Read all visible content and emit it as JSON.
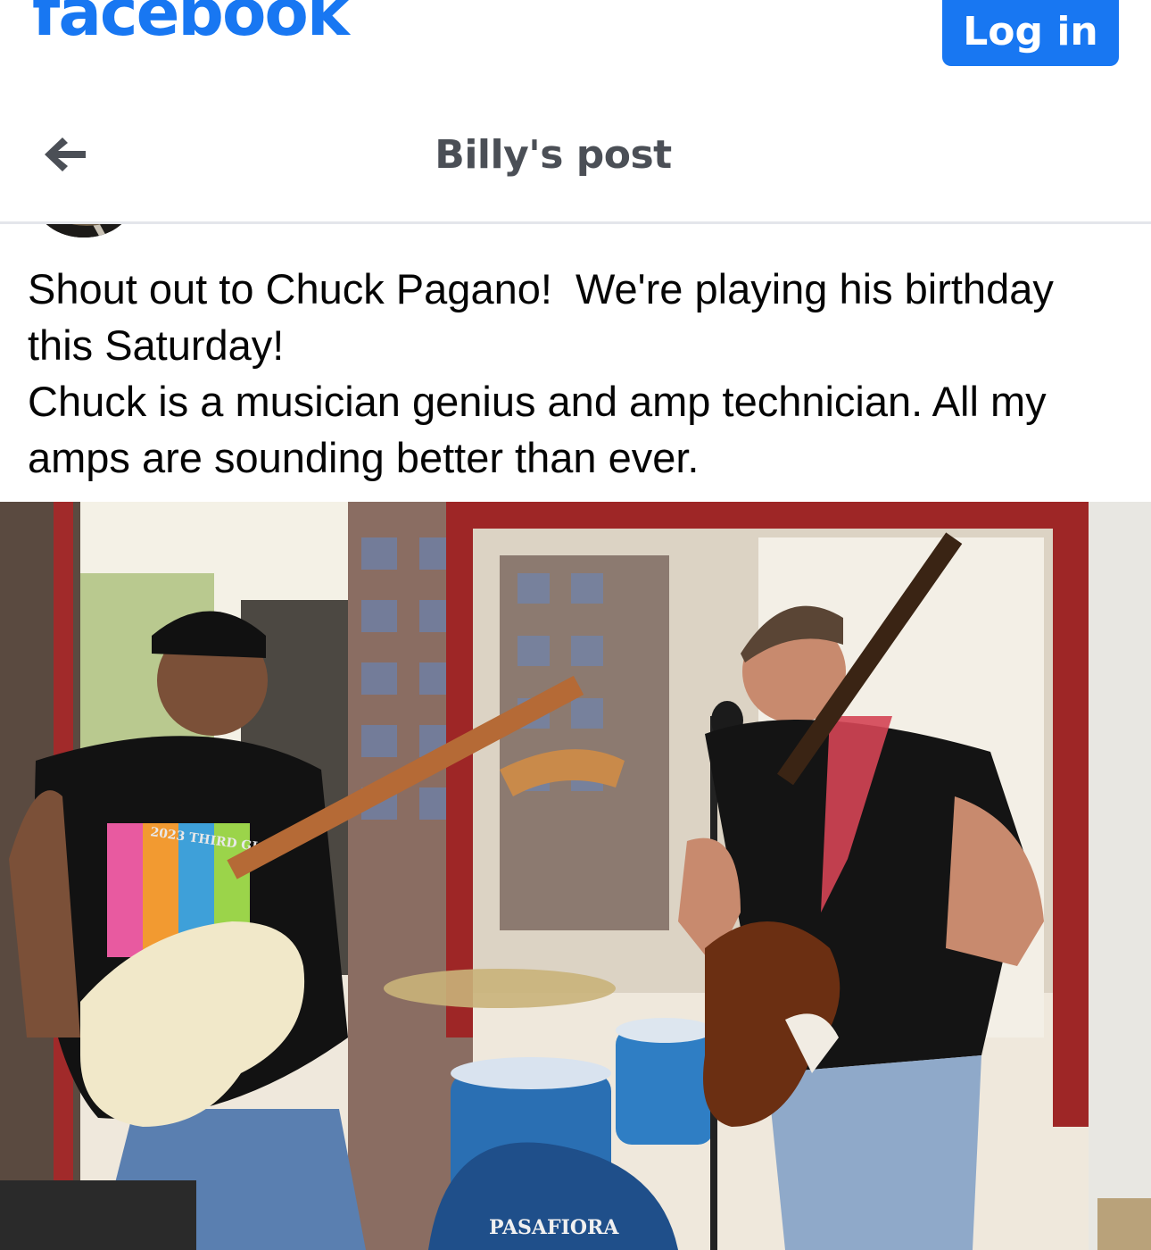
{
  "brand": {
    "logo_text": "facebook",
    "color": "#1877f2"
  },
  "header": {
    "login_label": "Log in"
  },
  "post_header": {
    "back_icon": "arrow-left-icon",
    "title": "Billy's post"
  },
  "post": {
    "lines": [
      "Shout out to Chuck Pagano!  We're playing his birthday this Saturday!",
      "Chuck is a musician genius and amp technician. All my amps are sounding better than ever."
    ]
  },
  "photo": {
    "shirt_print": "2023 THIRD GIG",
    "drum_brand": "PASAFIORA"
  }
}
